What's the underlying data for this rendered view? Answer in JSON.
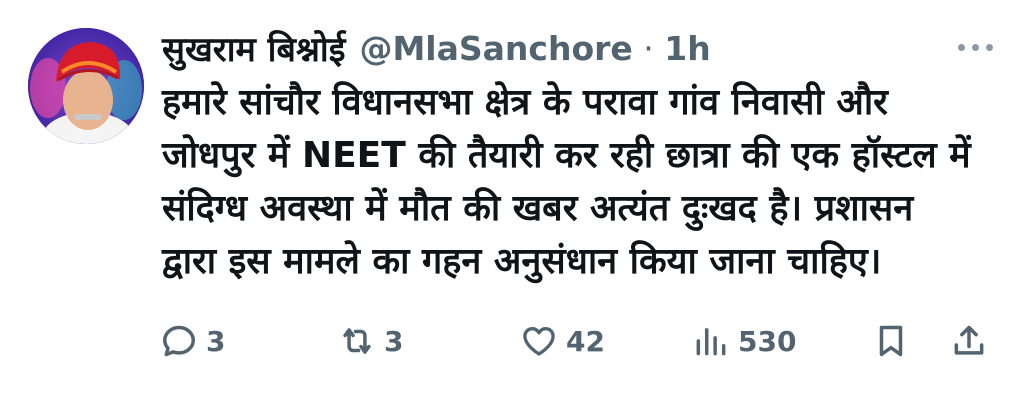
{
  "tweet": {
    "display_name": "सुखराम बिश्नोई",
    "handle": "@MlaSanchore",
    "separator": "·",
    "time": "1h",
    "lines": [
      "हमारे सांचौर विधानसभा क्षेत्र के परावा गांव निवासी और",
      "जोधपुर में NEET की तैयारी कर रही छात्रा की एक हॉस्टल में",
      "संदिग्ध अवस्था में मौत की खबर अत्यंत दुःखद है। प्रशासन",
      "द्वारा इस मामले का गहन अनुसंधान किया जाना चाहिए।"
    ]
  },
  "actions": {
    "reply_count": "3",
    "retweet_count": "3",
    "like_count": "42",
    "views_count": "530"
  },
  "icons": {
    "more": "more-dots-icon",
    "reply": "reply-bubble-icon",
    "retweet": "retweet-icon",
    "like": "heart-icon",
    "views": "views-bar-icon",
    "bookmark": "bookmark-icon",
    "share": "share-icon"
  },
  "colors": {
    "text": "#0f1419",
    "secondary": "#536471",
    "icon": "#536471"
  }
}
